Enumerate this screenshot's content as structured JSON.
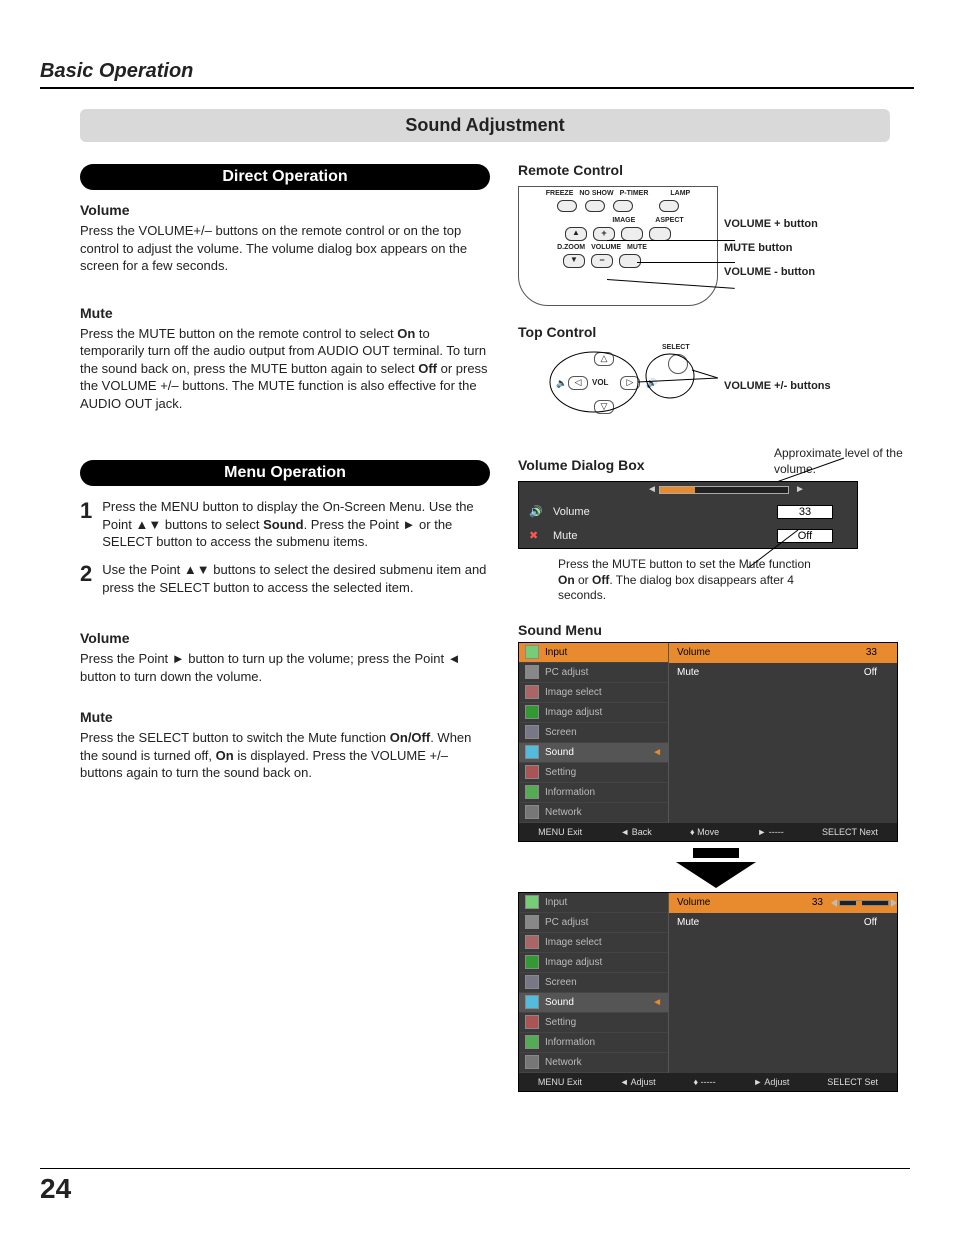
{
  "page": {
    "section": "Basic Operation",
    "title": "Sound Adjustment",
    "number": "24"
  },
  "direct": {
    "heading": "Direct Operation",
    "volume": {
      "h": "Volume",
      "p": "Press the VOLUME+/– buttons on the remote control or on the top control to adjust the volume. The volume dialog box appears on the screen for a few seconds."
    },
    "mute": {
      "h": "Mute",
      "p1": "Press the MUTE button on the remote control to select ",
      "on": "On",
      "p2": " to temporarily turn off the audio output from AUDIO OUT terminal. To turn the sound back on, press the MUTE button again to select ",
      "off": "Off",
      "p3": " or press the VOLUME +/– buttons. The MUTE function is also effective for the AUDIO OUT jack."
    }
  },
  "menu": {
    "heading": "Menu Operation",
    "step1a": "Press the MENU button to display the On-Screen Menu. Use the Point ▲▼ buttons to select ",
    "step1sound": "Sound",
    "step1b": ". Press the Point ► or the SELECT button to access the submenu items.",
    "step2": "Use the Point ▲▼ buttons to select the desired submenu item and press the SELECT button to access the selected item.",
    "volume": {
      "h": "Volume",
      "p": "Press the Point ► button to turn up the volume; press the Point ◄ button to turn down the volume."
    },
    "mute": {
      "h": "Mute",
      "p1": "Press the SELECT button to switch the Mute function ",
      "onoff": "On/Off",
      "p2": ". When the sound is turned off, ",
      "on": "On",
      "p3": " is displayed. Press the VOLUME +/– buttons again to turn the sound back on."
    }
  },
  "remote": {
    "h": "Remote Control",
    "top_labels": [
      "FREEZE",
      "NO SHOW",
      "P-TIMER",
      "LAMP"
    ],
    "mid_labels": [
      "IMAGE",
      "ASPECT"
    ],
    "side_labels": [
      "D.ZOOM",
      "VOLUME",
      "MUTE"
    ],
    "callouts": {
      "volp": "VOLUME + button",
      "mute": "MUTE button",
      "volm": "VOLUME - button"
    }
  },
  "topcontrol": {
    "h": "Top Control",
    "vol": "VOL",
    "select": "SELECT",
    "callout": "VOLUME +/- buttons"
  },
  "voldialog": {
    "h": "Volume Dialog Box",
    "approx_note": "Approximate level of the volume.",
    "rows": {
      "volume": "Volume",
      "mute": "Mute"
    },
    "vals": {
      "volume": "33",
      "mute": "Off"
    },
    "note1": "Press the MUTE button to set the Mute function ",
    "on": "On",
    "or": " or ",
    "off": "Off",
    "note2": ". The dialog box disappears after 4 seconds."
  },
  "soundmenu": {
    "h": "Sound Menu",
    "items": [
      "Input",
      "PC adjust",
      "Image select",
      "Image adjust",
      "Screen",
      "Sound",
      "Setting",
      "Information",
      "Network"
    ],
    "right_rows": {
      "volume": "Volume",
      "mute": "Mute"
    },
    "right_vals": {
      "volume": "33",
      "mute": "Off"
    },
    "footer1": {
      "exit": "MENU Exit",
      "back": "◄ Back",
      "move": "♦ Move",
      "dash": "► -----",
      "next": "SELECT Next"
    },
    "footer2": {
      "exit": "MENU Exit",
      "back": "◄ Adjust",
      "move": "♦ -----",
      "dash": "► Adjust",
      "next": "SELECT Set"
    }
  }
}
